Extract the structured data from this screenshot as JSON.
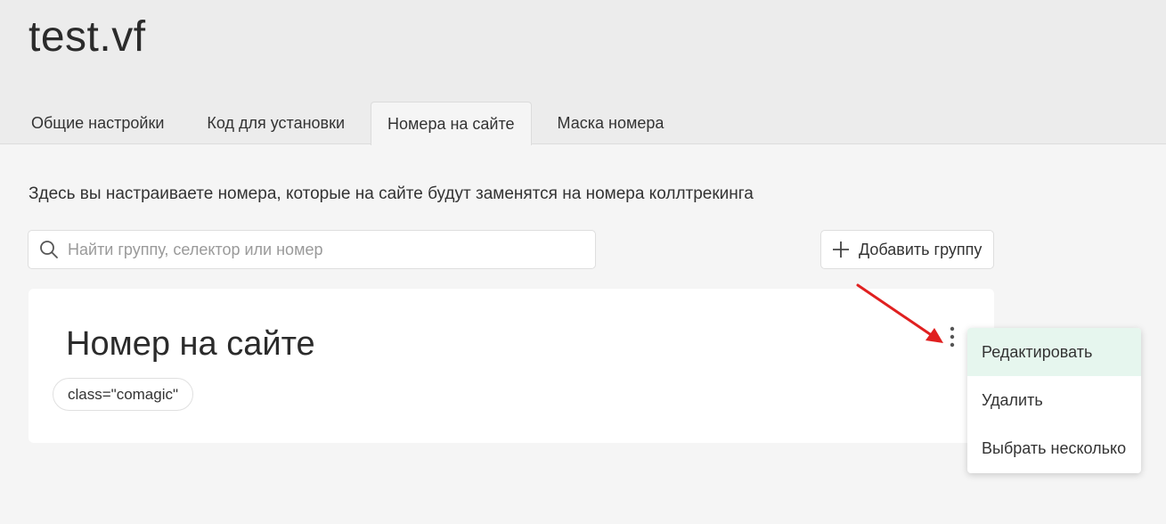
{
  "site": {
    "title": "test.vf"
  },
  "tabs": [
    {
      "label": "Общие настройки",
      "active": false
    },
    {
      "label": "Код для установки",
      "active": false
    },
    {
      "label": "Номера на сайте",
      "active": true
    },
    {
      "label": "Маска номера",
      "active": false
    }
  ],
  "description": "Здесь вы настраиваете номера, которые на сайте будут заменятся на номера коллтрекинга",
  "search": {
    "placeholder": "Найти группу, селектор или номер",
    "value": "",
    "icon": "search-icon"
  },
  "add_group_button": {
    "label": "Добавить группу",
    "icon": "plus-icon"
  },
  "group": {
    "title": "Номер на сайте",
    "selector": "class=\"comagic\"",
    "menu_icon": "kebab-menu-icon"
  },
  "menu": {
    "items": [
      {
        "label": "Редактировать",
        "highlighted": true
      },
      {
        "label": "Удалить",
        "highlighted": false
      },
      {
        "label": "Выбрать несколько",
        "highlighted": false
      }
    ]
  },
  "colors": {
    "header_bg": "#ececec",
    "page_bg": "#f5f5f5",
    "menu_highlight": "#e6f6ee",
    "annotation_arrow": "#e02020"
  }
}
